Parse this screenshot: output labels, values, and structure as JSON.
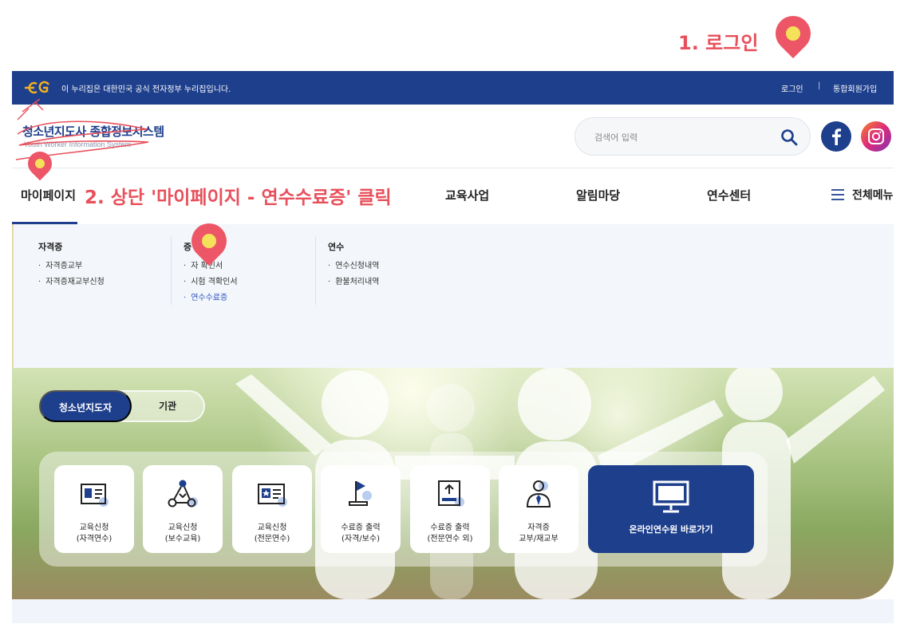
{
  "annotations": {
    "step1": "1. 로그인",
    "step2": "2. 상단 '마이페이지 - 연수수료증' 클릭"
  },
  "topbar": {
    "gov_notice": "이 누리집은 대한민국 공식 전자정부 누리집입니다.",
    "login": "로그인",
    "separator": "|",
    "join": "통합회원가입"
  },
  "header": {
    "logo_title": "청소년지도사 종합정보시스템",
    "logo_subtitle": "Youth Worker Information System",
    "search_placeholder": "검색어 입력",
    "social": [
      "facebook-icon",
      "instagram-icon"
    ]
  },
  "nav": {
    "mypage": "마이페이지",
    "education": "교육사업",
    "notice": "알림마당",
    "training_center": "연수센터",
    "all_menu": "전체메뉴"
  },
  "dropdown": {
    "columns": [
      {
        "title": "자격증",
        "items": [
          "자격증교부",
          "자격증재교부신청"
        ]
      },
      {
        "title": "증",
        "items": [
          "자 확인서",
          "시험 격확인서",
          "연수수료증"
        ]
      },
      {
        "title": "연수",
        "items": [
          "연수신청내역",
          "환불처리내역"
        ]
      }
    ],
    "active_item": "연수수료증"
  },
  "hero": {
    "tabs": [
      "청소년지도자",
      "기관"
    ],
    "active_tab": "청소년지도자",
    "quick_links": [
      {
        "icon": "application-icon",
        "line1": "교육신청",
        "line2": "(자격연수)"
      },
      {
        "icon": "network-icon",
        "line1": "교육신청",
        "line2": "(보수교육)"
      },
      {
        "icon": "id-card-icon",
        "line1": "교육신청",
        "line2": "(전문연수)"
      },
      {
        "icon": "flag-icon",
        "line1": "수료증 출력",
        "line2": "(자격/보수)"
      },
      {
        "icon": "upload-icon",
        "line1": "수료증 출력",
        "line2": "(전문연수 외)"
      },
      {
        "icon": "person-tie-icon",
        "line1": "자격증",
        "line2": "교부/재교부"
      }
    ],
    "online_link": {
      "icon": "monitor-icon",
      "label": "온라인연수원 바로가기"
    }
  },
  "colors": {
    "brand_navy": "#1e3f8c",
    "annotation_red": "#e8505b",
    "pin_yellow": "#f6e25a",
    "active_link": "#2f55c4"
  }
}
